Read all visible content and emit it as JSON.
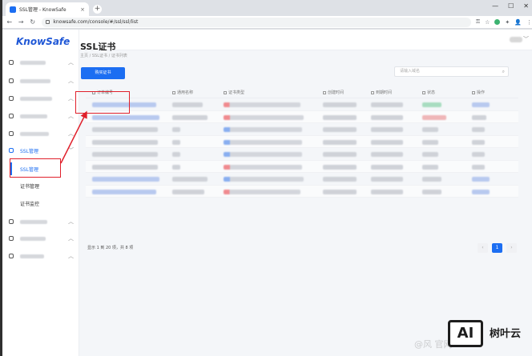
{
  "browser": {
    "tab_title": "SSL管理 - KnowSafe",
    "tab_close": "×",
    "new_tab": "+",
    "url": "knowsafe.com/console/#/ssl/ssl/list",
    "win_min": "—",
    "win_max": "☐",
    "win_close": "✕",
    "back": "←",
    "forward": "→",
    "reload": "↻",
    "key": "⚿",
    "star": "☆",
    "puzzle": "✦",
    "profile": "👤",
    "menu": "⋮"
  },
  "sidebar": {
    "logo": "KnowSafe",
    "ssl_group_label": "SSL管理",
    "sub_items": [
      {
        "label": "SSL管理"
      },
      {
        "label": "证书管理"
      },
      {
        "label": "证书监控"
      }
    ]
  },
  "main": {
    "title": "SSL证书",
    "breadcrumb": "主页 / SSL证书 / 证书列表",
    "buy_button": "购买证书",
    "search_placeholder": "请输入域名"
  },
  "table": {
    "headers": [
      "订单编号",
      "通用名称",
      "证书类型",
      "创建时间",
      "到期时间",
      "状态",
      "操作"
    ]
  },
  "footer": {
    "summary": "显示 1 到 20 项，共 8 项",
    "pagination": {
      "prev": "‹",
      "current": "1",
      "next": "›"
    }
  },
  "watermark": {
    "box_text": "AI",
    "brand": "树叶云",
    "bg_text": "@风 官网"
  },
  "colors": {
    "accent": "#1c6ef2",
    "annotation": "#e0202b"
  }
}
